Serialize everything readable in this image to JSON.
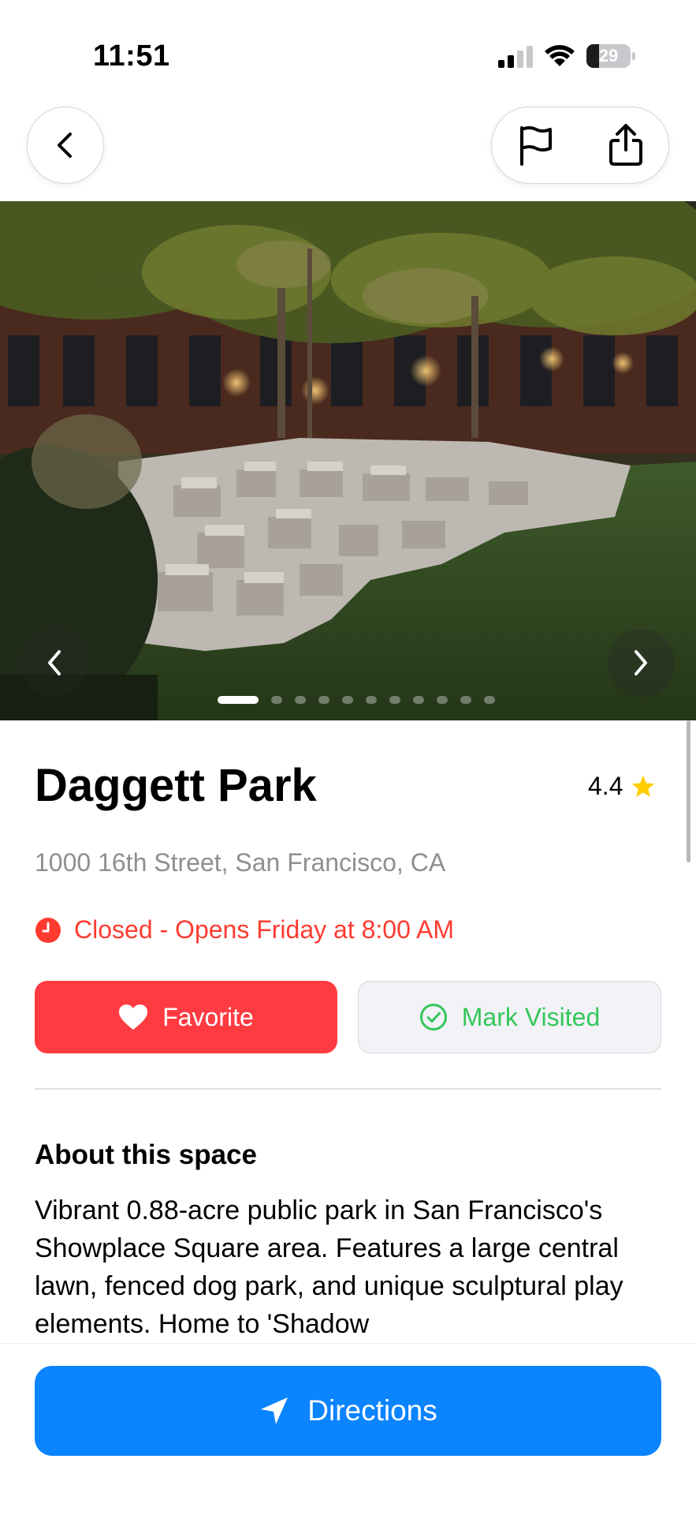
{
  "status_bar": {
    "time": "11:51",
    "battery_level": "29"
  },
  "nav": {
    "back_icon": "chevron-left-icon",
    "report_icon": "flag-icon",
    "share_icon": "share-icon"
  },
  "carousel": {
    "image_count": 11,
    "active_index": 0,
    "prev_icon": "chevron-left-icon",
    "next_icon": "chevron-right-icon"
  },
  "place": {
    "name": "Daggett Park",
    "rating": "4.4",
    "address": "1000 16th Street, San Francisco, CA",
    "hours_status": "Closed - Opens Friday at 8:00 AM"
  },
  "actions": {
    "favorite_label": "Favorite",
    "mark_visited_label": "Mark Visited"
  },
  "about": {
    "title": "About this space",
    "description": "Vibrant 0.88-acre public park in San Francisco's Showplace Square area. Features a large central lawn, fenced dog park, and unique sculptural play elements. Home to 'Shadow"
  },
  "directions": {
    "label": "Directions"
  },
  "colors": {
    "accent_blue": "#0a84ff",
    "favorite_red": "#ff3b42",
    "closed_red": "#ff3b30",
    "visited_green": "#34c759",
    "star_yellow": "#ffcc00"
  }
}
